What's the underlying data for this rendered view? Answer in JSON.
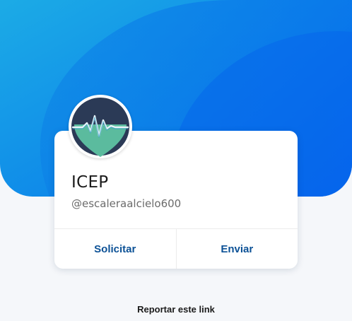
{
  "profile": {
    "name": "ICEP",
    "handle": "@escaleraalcielo600",
    "avatar_icon": "heart-heartbeat-icon"
  },
  "actions": {
    "request_label": "Solicitar",
    "send_label": "Enviar"
  },
  "footer": {
    "report_label": "Reportar este link"
  },
  "colors": {
    "hero_light": "#1aa3e8",
    "hero_dark": "#0a73ea",
    "action_text": "#0c5196",
    "avatar_dark": "#2a3a55",
    "avatar_teal": "#5ab89d"
  }
}
